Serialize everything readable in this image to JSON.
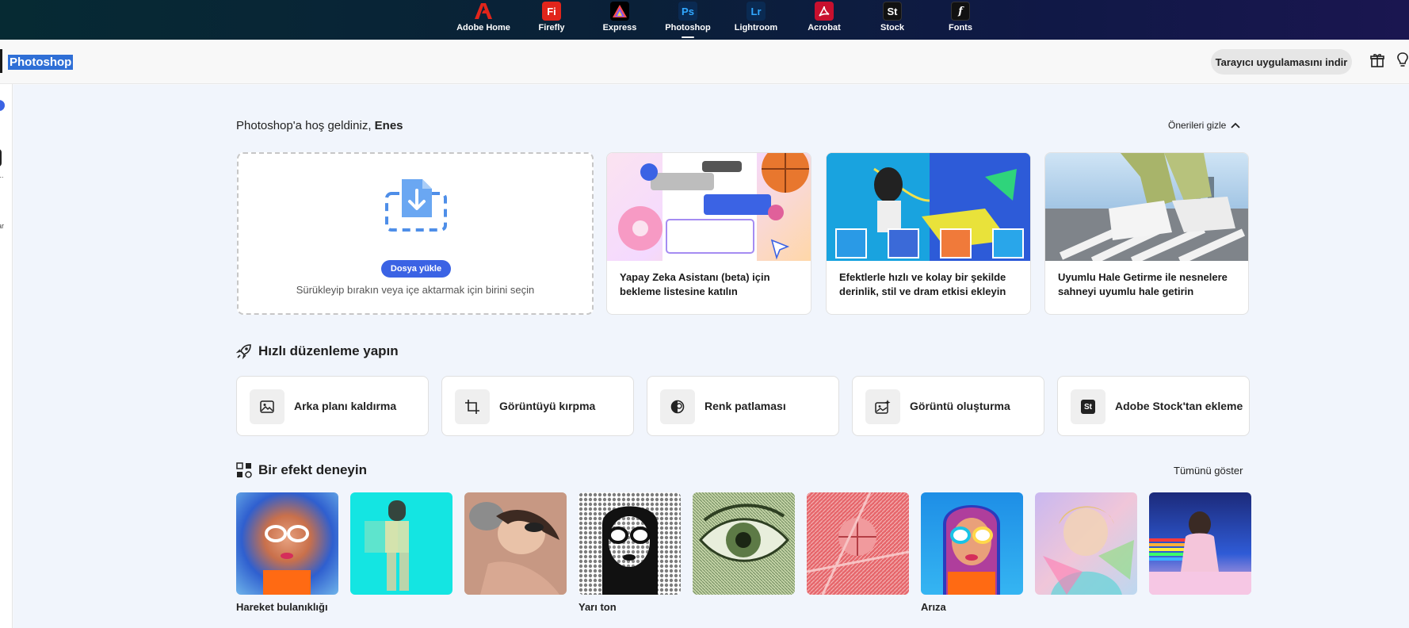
{
  "apps": [
    {
      "label": "Adobe Home",
      "icon": "adobe-home-icon",
      "glyph": "",
      "color": "#e1251b"
    },
    {
      "label": "Firefly",
      "icon": "firefly-icon",
      "glyph": "Fi",
      "color": "#e1251b"
    },
    {
      "label": "Express",
      "icon": "express-icon",
      "glyph": "",
      "color": "#000000"
    },
    {
      "label": "Photoshop",
      "icon": "photoshop-icon",
      "glyph": "Ps",
      "color": "#0a2a52",
      "active": true
    },
    {
      "label": "Lightroom",
      "icon": "lightroom-icon",
      "glyph": "Lr",
      "color": "#0a2a52"
    },
    {
      "label": "Acrobat",
      "icon": "acrobat-icon",
      "glyph": "",
      "color": "#c8102e"
    },
    {
      "label": "Stock",
      "icon": "stock-icon",
      "glyph": "St",
      "color": "#111111"
    },
    {
      "label": "Fonts",
      "icon": "fonts-icon",
      "glyph": "f",
      "color": "#111111"
    }
  ],
  "header": {
    "title": "Photoshop",
    "download_label": "Tarayıcı uygulamasını indir"
  },
  "rail": {
    "item1": "r",
    "item2": "...",
    "item3": "ar"
  },
  "welcome": {
    "prefix": "Photoshop'a hoş geldiniz, ",
    "name": "Enes",
    "hide_label": "Önerileri gizle"
  },
  "upload": {
    "button": "Dosya yükle",
    "hint": "Sürükleyip bırakın veya içe aktarmak için birini seçin"
  },
  "cards": [
    {
      "line1": "Yapay Zeka Asistanı (beta) için",
      "line2": "bekleme listesine katılın"
    },
    {
      "line1": "Efektlerle hızlı ve kolay bir şekilde",
      "line2": "derinlik, stil ve dram etkisi ekleyin"
    },
    {
      "line1": "Uyumlu Hale Getirme ile nesnelere",
      "line2": "sahneyi uyumlu hale getirin"
    }
  ],
  "quick": {
    "title": "Hızlı düzenleme yapın",
    "actions": [
      {
        "label": "Arka planı kaldırma",
        "icon": "image-icon"
      },
      {
        "label": "Görüntüyü kırpma",
        "icon": "crop-icon"
      },
      {
        "label": "Renk patlaması",
        "icon": "color-pop-icon"
      },
      {
        "label": "Görüntü oluşturma",
        "icon": "generate-image-icon"
      },
      {
        "label": "Adobe Stock'tan ekleme",
        "icon": "stock-icon"
      }
    ]
  },
  "effects": {
    "title": "Bir efekt deneyin",
    "show_all": "Tümünü göster",
    "labels": [
      "Hareket bulanıklığı",
      "Yarı ton",
      "Arıza"
    ]
  }
}
